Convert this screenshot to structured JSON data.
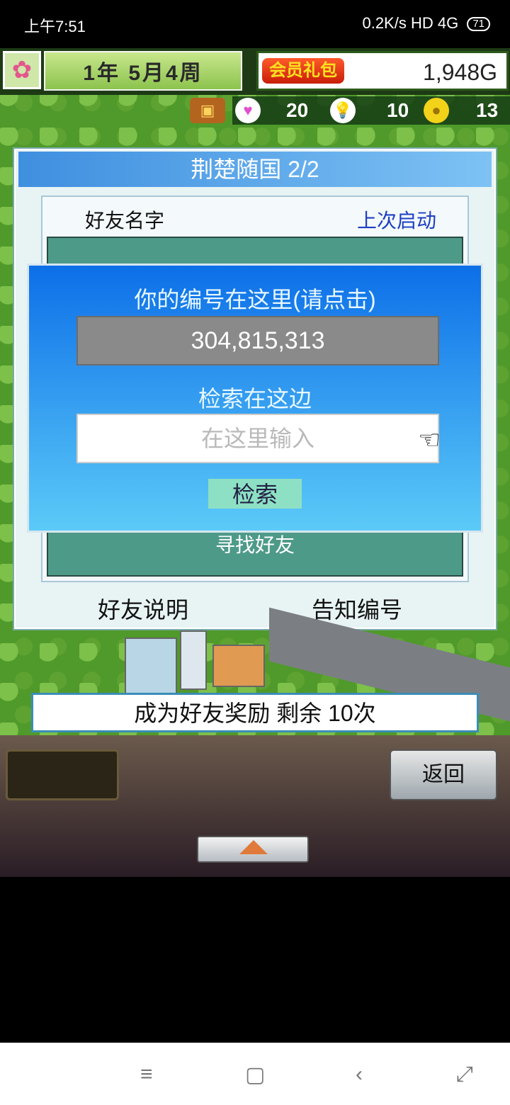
{
  "status_bar": {
    "time": "上午7:51",
    "network": "0.2K/s HD 4G",
    "battery": "71"
  },
  "hud": {
    "date": "1年 5月4周",
    "vip_label": "会员礼包",
    "money": "1,948G",
    "hearts": "20",
    "ideas": "10",
    "coins": "13"
  },
  "dialog": {
    "title": "荆楚随国 2/2",
    "col_name": "好友名字",
    "col_last": "上次启动",
    "find_friend": "寻找好友",
    "friend_help": "好友说明",
    "share_id": "告知编号"
  },
  "popup": {
    "title": "你的编号在这里(请点击)",
    "id_value": "304,815,313",
    "search_label": "检索在这边",
    "search_placeholder": "在这里输入",
    "search_button": "检索"
  },
  "bonus": {
    "text": "成为好友奖励 剩余 10次"
  },
  "menu": {
    "back_label": "返回"
  },
  "navbar": {
    "menu_icon": "≡",
    "home_icon": "▢",
    "back_icon": "‹",
    "recent_icon": "⤢"
  }
}
